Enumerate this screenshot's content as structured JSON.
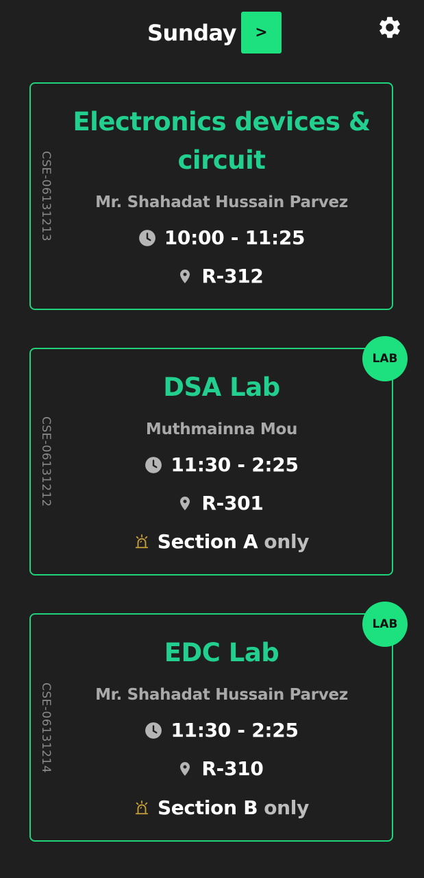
{
  "header": {
    "day": "Sunday",
    "next_label": ">",
    "settings_icon": "gear-icon"
  },
  "colors": {
    "background": "#1f1f1f",
    "accent": "#1de17f",
    "title": "#22cf8f",
    "alarm": "#c9a13b"
  },
  "classes": [
    {
      "code": "CSE-06131213",
      "title": "Electronics devices & circuit",
      "teacher": "Mr. Shahadat Hussain Parvez",
      "time": "10:00 - 11:25",
      "room": "R-312"
    },
    {
      "code": "CSE-06131212",
      "title": "DSA Lab",
      "teacher": "Muthmainna Mou",
      "time": "11:30 - 2:25",
      "room": "R-301",
      "badge": "LAB",
      "section": "Section A",
      "section_suffix": "only"
    },
    {
      "code": "CSE-06131214",
      "title": "EDC Lab",
      "teacher": "Mr. Shahadat Hussain Parvez",
      "time": "11:30 - 2:25",
      "room": "R-310",
      "badge": "LAB",
      "section": "Section B",
      "section_suffix": "only"
    }
  ]
}
